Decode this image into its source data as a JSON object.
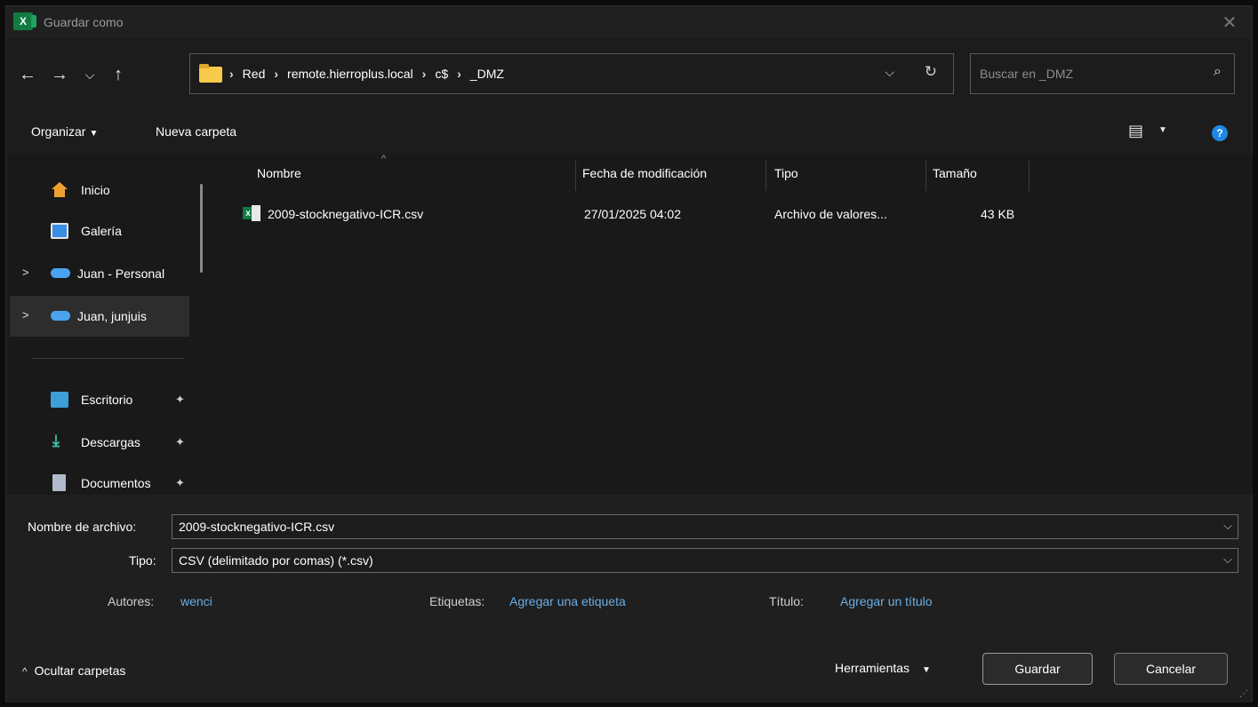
{
  "window": {
    "title": "Guardar como",
    "app_icon": "excel-icon",
    "close_glyph": "✕"
  },
  "nav": {
    "back_glyph": "←",
    "forward_glyph": "→",
    "recent_glyph": "⌵",
    "up_glyph": "↑",
    "breadcrumbs": [
      "Red",
      "remote.hierroplus.local",
      "c$",
      "_DMZ"
    ],
    "crumb_separator": "›",
    "dropdown_glyph": "⌵",
    "refresh_glyph": "↻",
    "search_placeholder": "Buscar en _DMZ",
    "search_glyph": "⌕"
  },
  "toolbar": {
    "organize_label": "Organizar",
    "organize_caret": "▼",
    "new_folder_label": "Nueva carpeta",
    "view_glyph": "▤",
    "view_caret": "▼",
    "help_glyph": "?"
  },
  "sidebar": {
    "items": [
      {
        "label": "Inicio",
        "icon": "home-icon"
      },
      {
        "label": "Galería",
        "icon": "gallery-icon"
      },
      {
        "label": "Juan - Personal",
        "icon": "onedrive-icon"
      },
      {
        "label": "Juan, junjuis",
        "icon": "onedrive-icon",
        "selected": true
      },
      {
        "label": "Escritorio",
        "icon": "desktop-icon",
        "pinned": true
      },
      {
        "label": "Descargas",
        "icon": "download-icon",
        "pinned": true
      },
      {
        "label": "Documentos",
        "icon": "documents-icon",
        "pinned": true
      }
    ],
    "expand_glyph": ">",
    "pin_glyph": "📌",
    "download_glyph": "⤓"
  },
  "filelist": {
    "columns": [
      "Nombre",
      "Fecha de modificación",
      "Tipo",
      "Tamaño"
    ],
    "sort_glyph": "^",
    "rows": [
      {
        "name": "2009-stocknegativo-ICR.csv",
        "modified": "27/01/2025 04:02",
        "type": "Archivo de valores...",
        "size": "43 KB"
      }
    ]
  },
  "form": {
    "filename_label": "Nombre de archivo:",
    "filename_value": "2009-stocknegativo-ICR.csv",
    "type_label": "Tipo:",
    "type_value": "CSV (delimitado por comas) (*.csv)",
    "combo_caret": "⌵",
    "authors_label": "Autores:",
    "authors_value": "wenci",
    "tags_label": "Etiquetas:",
    "tags_value": "Agregar una etiqueta",
    "title_label": "Título:",
    "title_value": "Agregar un título"
  },
  "footer": {
    "hide_folders_label": "Ocultar carpetas",
    "hide_glyph": "^",
    "tools_label": "Herramientas",
    "tools_caret": "▼",
    "save_label": "Guardar",
    "cancel_label": "Cancelar",
    "grip_glyph": "⋰"
  },
  "colors": {
    "accent_link": "#6aaee6",
    "help_blue": "#1e88e5",
    "excel_green": "#107c41"
  }
}
